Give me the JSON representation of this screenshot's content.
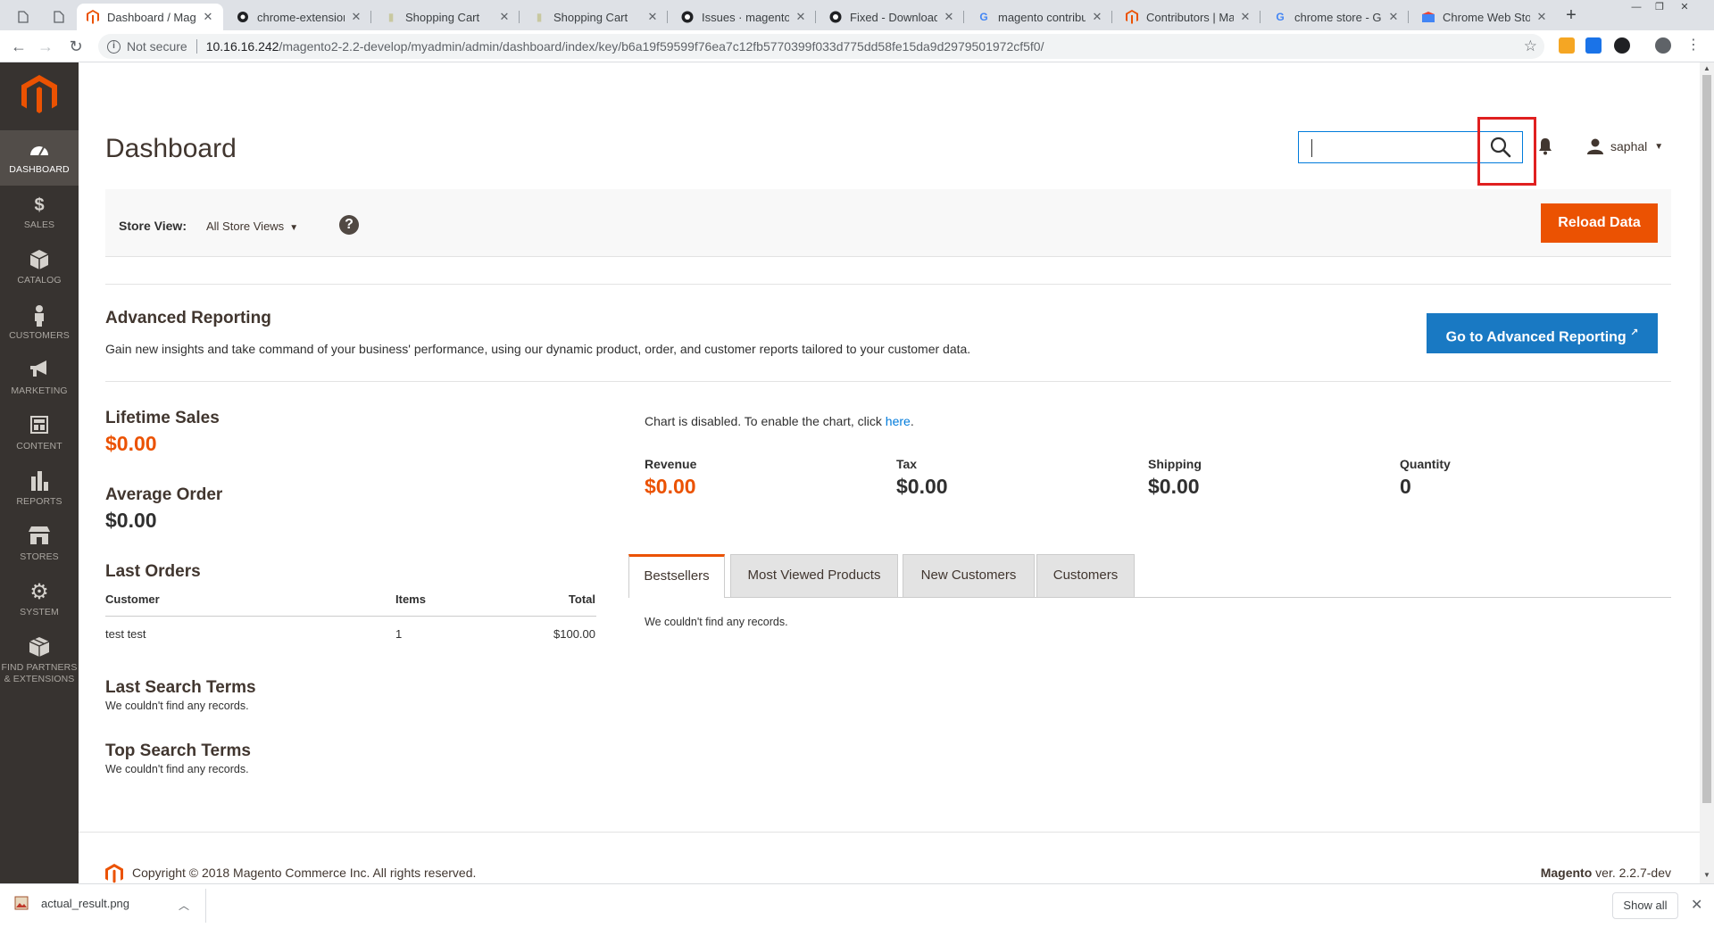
{
  "browser": {
    "tabs": [
      {
        "title": "",
        "icon": "page-icon"
      },
      {
        "title": "",
        "icon": "page-icon"
      },
      {
        "title": "Dashboard / Mage",
        "icon": "magento-icon",
        "active": true
      },
      {
        "title": "chrome-extension",
        "icon": "chrome-icon"
      },
      {
        "title": "Shopping Cart",
        "icon": "page-icon"
      },
      {
        "title": "Shopping Cart",
        "icon": "page-icon"
      },
      {
        "title": "Issues · magento/n",
        "icon": "github-icon"
      },
      {
        "title": "Fixed - Downloada",
        "icon": "github-icon"
      },
      {
        "title": "magento contribut",
        "icon": "google-icon"
      },
      {
        "title": "Contributors | Mag",
        "icon": "magento-icon"
      },
      {
        "title": "chrome store - Goo",
        "icon": "google-icon"
      },
      {
        "title": "Chrome Web Store",
        "icon": "webstore-icon"
      }
    ],
    "not_secure": "Not secure",
    "url_host": "10.16.16.242",
    "url_path": "/magento2-2.2-develop/myadmin/admin/dashboard/index/key/b6a19f59599f76ea7c12fb5770399f033d775dd58fe15da9d2979501972cf5f0/"
  },
  "nav": {
    "items": [
      {
        "label": "Dashboard",
        "icon": "dashboard-icon"
      },
      {
        "label": "Sales",
        "icon": "dollar-icon"
      },
      {
        "label": "Catalog",
        "icon": "box-icon"
      },
      {
        "label": "Customers",
        "icon": "person-icon"
      },
      {
        "label": "Marketing",
        "icon": "megaphone-icon"
      },
      {
        "label": "Content",
        "icon": "layout-icon"
      },
      {
        "label": "Reports",
        "icon": "bar-chart-icon"
      },
      {
        "label": "Stores",
        "icon": "store-icon"
      },
      {
        "label": "System",
        "icon": "gear-icon"
      },
      {
        "label": "Find Partners",
        "label2": "& Extensions",
        "icon": "cube-icon"
      }
    ]
  },
  "header": {
    "title": "Dashboard",
    "search_value": "",
    "user": "saphal"
  },
  "store": {
    "label": "Store View:",
    "selected": "All Store Views",
    "help": "?",
    "reload": "Reload Data"
  },
  "advanced": {
    "title": "Advanced Reporting",
    "text": "Gain new insights and take command of your business' performance, using our dynamic product, order, and customer reports tailored to your customer data.",
    "button": "Go to Advanced Reporting"
  },
  "stats": {
    "lifetime_label": "Lifetime Sales",
    "lifetime_value": "$0.00",
    "average_label": "Average Order",
    "average_value": "$0.00"
  },
  "last_orders": {
    "title": "Last Orders",
    "columns": [
      "Customer",
      "Items",
      "Total"
    ],
    "rows": [
      [
        "test test",
        "1",
        "$100.00"
      ]
    ]
  },
  "search_terms": {
    "last_title": "Last Search Terms",
    "last_empty": "We couldn't find any records.",
    "top_title": "Top Search Terms",
    "top_empty": "We couldn't find any records."
  },
  "chart": {
    "note": "Chart is disabled. To enable the chart, click ",
    "link": "here",
    "end": "."
  },
  "totals": [
    {
      "label": "Revenue",
      "value": "$0.00"
    },
    {
      "label": "Tax",
      "value": "$0.00"
    },
    {
      "label": "Shipping",
      "value": "$0.00"
    },
    {
      "label": "Quantity",
      "value": "0"
    }
  ],
  "grid_tabs": {
    "tabs": [
      "Bestsellers",
      "Most Viewed Products",
      "New Customers",
      "Customers"
    ],
    "empty": "We couldn't find any records."
  },
  "footer": {
    "copyright": "Copyright © 2018 Magento Commerce Inc. All rights reserved.",
    "brand": "Magento",
    "version": " ver. 2.2.7-dev"
  },
  "download": {
    "file": "actual_result.png",
    "show_all": "Show all"
  },
  "colors": {
    "accent": "#eb5202",
    "nav_bg": "#373330",
    "link": "#007bdb",
    "highlight": "#e02020"
  }
}
